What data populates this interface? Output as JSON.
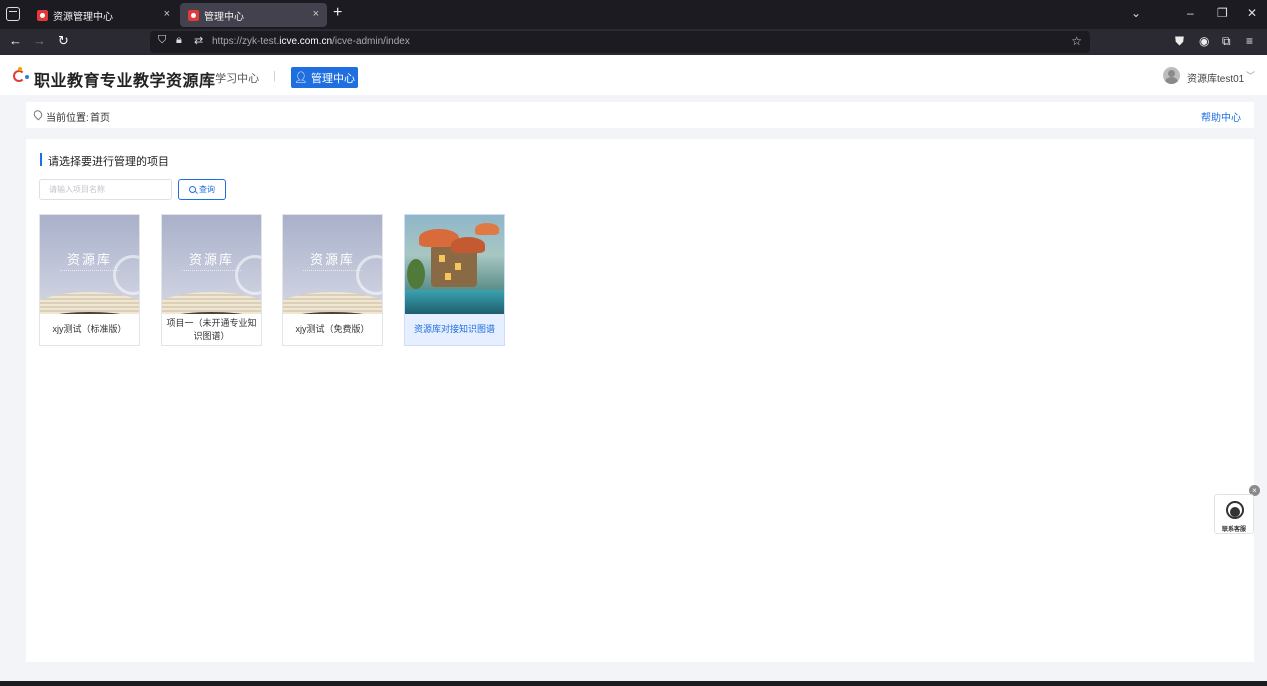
{
  "browser": {
    "tabs": [
      {
        "title": "资源管理中心",
        "active": false
      },
      {
        "title": "管理中心",
        "active": true
      }
    ],
    "close_glyph": "×",
    "new_tab_glyph": "+",
    "url_prefix": "https://zyk-test.",
    "url_host": "icve.com.cn",
    "url_path": "/icve-admin/index"
  },
  "header": {
    "logo_text": "职业教育专业教学资源库",
    "study_center": "学习中心",
    "separator": "|",
    "manage_center": "管理中心",
    "username": "资源库test01"
  },
  "breadcrumb": {
    "label": "当前位置:",
    "current": "首页",
    "help": "帮助中心"
  },
  "main": {
    "title": "请选择要进行管理的项目",
    "search_placeholder": "请输入项目名称",
    "query_button": "查询",
    "projects": [
      {
        "name": "xjy测试（标准版）",
        "cover_text": "资源库",
        "cover_type": "book"
      },
      {
        "name": "项目一（未开通专业知识图谱）",
        "cover_text": "资源库",
        "cover_type": "book"
      },
      {
        "name": "xjy测试（免费版）",
        "cover_text": "资源库",
        "cover_type": "book"
      },
      {
        "name": "资源库对接知识图谱",
        "cover_text": "",
        "cover_type": "art",
        "highlighted": true
      }
    ]
  },
  "widget": {
    "label": "联系客服",
    "close_glyph": "×"
  },
  "colors": {
    "accent": "#1f6fe0",
    "page_bg": "#f2f4f8",
    "browser_dark": "#1c1b22"
  }
}
